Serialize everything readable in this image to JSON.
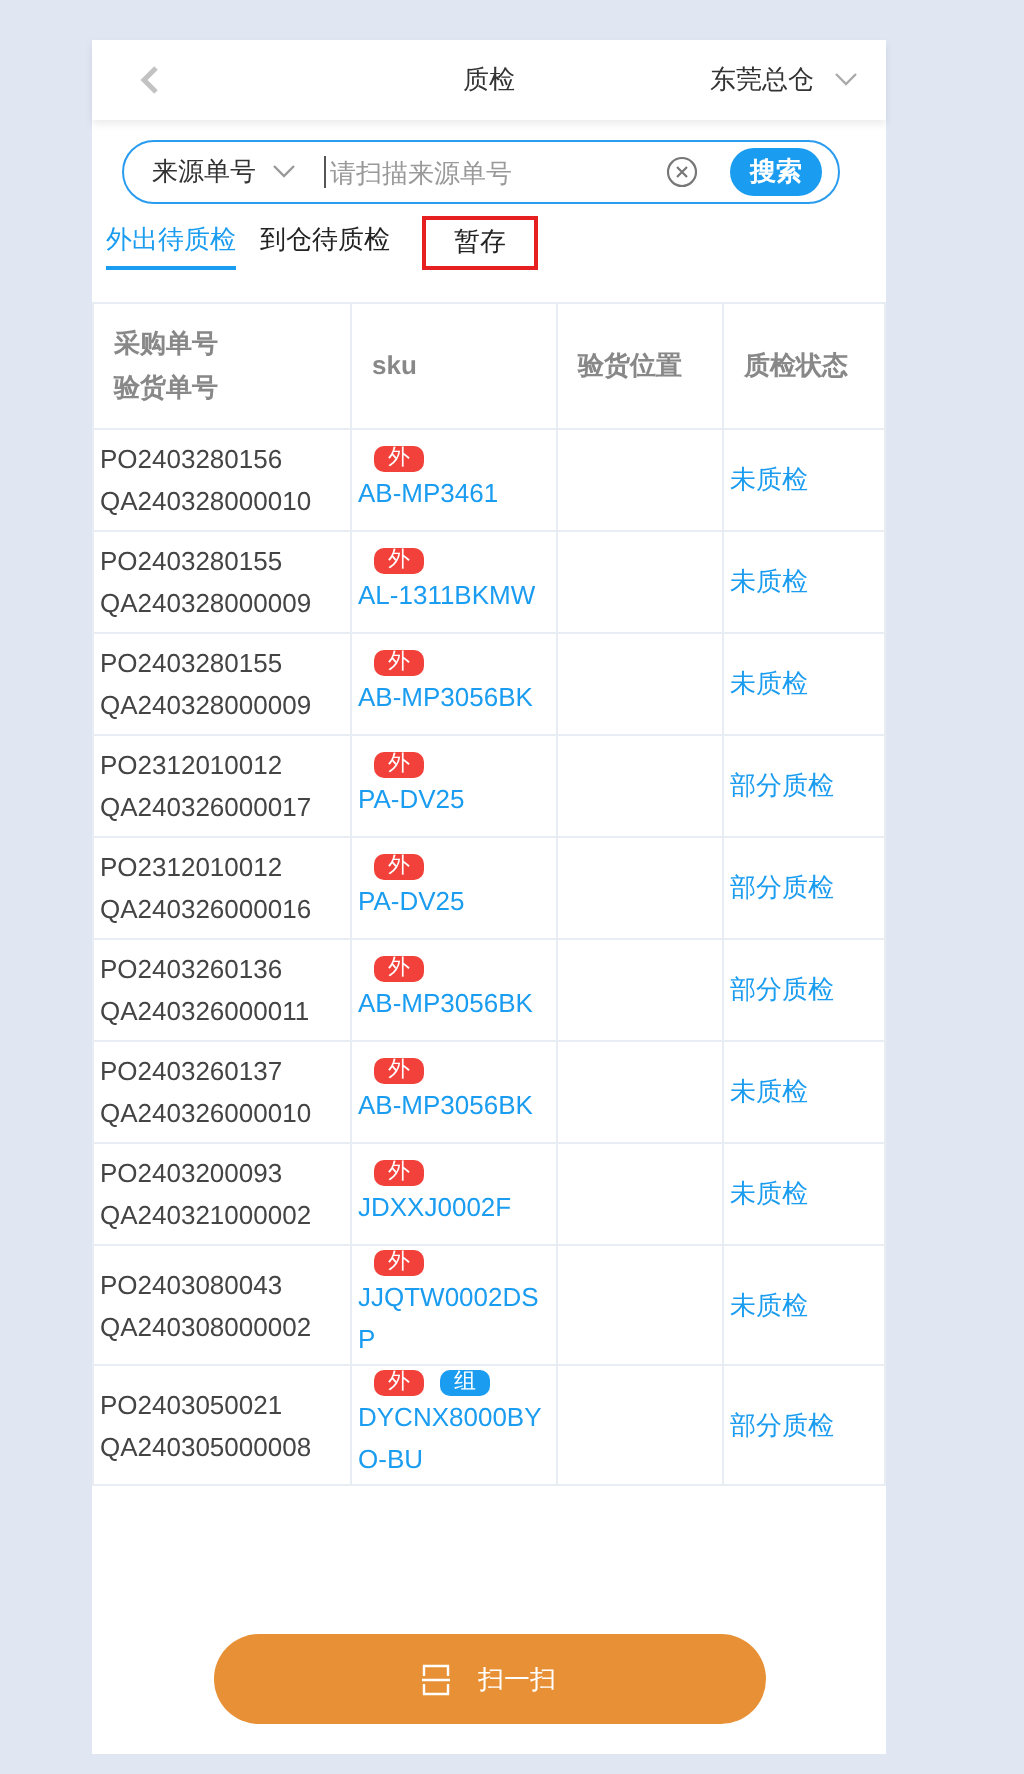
{
  "header": {
    "title": "质检",
    "warehouse": "东莞总仓"
  },
  "search": {
    "type": "来源单号",
    "placeholder": "请扫描来源单号",
    "button": "搜索"
  },
  "tabs": [
    {
      "label": "外出待质检",
      "selected": true,
      "outlined": false
    },
    {
      "label": "到仓待质检",
      "selected": false,
      "outlined": false
    },
    {
      "label": "暂存",
      "selected": false,
      "outlined": true
    }
  ],
  "table": {
    "columns": [
      [
        "采购单号",
        "验货单号"
      ],
      [
        "sku"
      ],
      [
        "验货位置"
      ],
      [
        "质检状态"
      ]
    ],
    "rows": [
      {
        "po": "PO2403280156",
        "qa": "QA240328000010",
        "tags": [
          {
            "label": "外",
            "color": "#f2413a"
          }
        ],
        "sku": "AB-MP3461",
        "status": "未质检"
      },
      {
        "po": "PO2403280155",
        "qa": "QA240328000009",
        "tags": [
          {
            "label": "外",
            "color": "#f2413a"
          }
        ],
        "sku": "AL-1311BKMW",
        "status": "未质检"
      },
      {
        "po": "PO2403280155",
        "qa": "QA240328000009",
        "tags": [
          {
            "label": "外",
            "color": "#f2413a"
          }
        ],
        "sku": "AB-MP3056BK",
        "status": "未质检"
      },
      {
        "po": "PO2312010012",
        "qa": "QA240326000017",
        "tags": [
          {
            "label": "外",
            "color": "#f2413a"
          }
        ],
        "sku": "PA-DV25",
        "status": "部分质检"
      },
      {
        "po": "PO2312010012",
        "qa": "QA240326000016",
        "tags": [
          {
            "label": "外",
            "color": "#f2413a"
          }
        ],
        "sku": "PA-DV25",
        "status": "部分质检"
      },
      {
        "po": "PO2403260136",
        "qa": "QA240326000011",
        "tags": [
          {
            "label": "外",
            "color": "#f2413a"
          }
        ],
        "sku": "AB-MP3056BK",
        "status": "部分质检"
      },
      {
        "po": "PO2403260137",
        "qa": "QA240326000010",
        "tags": [
          {
            "label": "外",
            "color": "#f2413a"
          }
        ],
        "sku": "AB-MP3056BK",
        "status": "未质检"
      },
      {
        "po": "PO2403200093",
        "qa": "QA240321000002",
        "tags": [
          {
            "label": "外",
            "color": "#f2413a"
          }
        ],
        "sku": "JDXXJ0002F",
        "status": "未质检"
      },
      {
        "po": "PO2403080043",
        "qa": "QA240308000002",
        "tags": [
          {
            "label": "外",
            "color": "#f2413a"
          }
        ],
        "sku": "JJQTW0002DSP",
        "status": "未质检"
      },
      {
        "po": "PO2403050021",
        "qa": "QA240305000008",
        "tags": [
          {
            "label": "外",
            "color": "#f2413a"
          },
          {
            "label": "组",
            "color": "#1a9cf0"
          }
        ],
        "sku": "DYCNX8000BYO-BU",
        "status": "部分质检"
      }
    ]
  },
  "scan_button": "扫一扫"
}
